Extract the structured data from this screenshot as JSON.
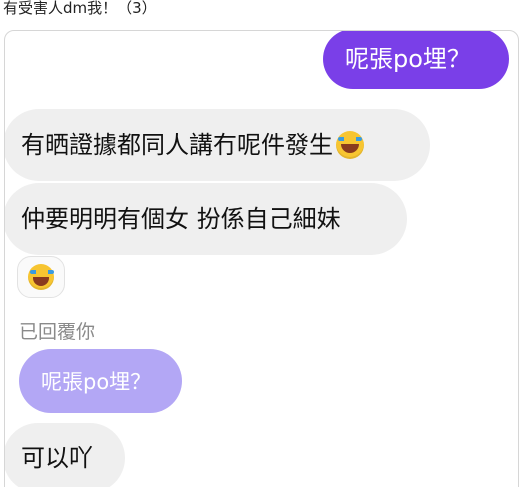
{
  "post": {
    "title": "有受害人dm我！（3）"
  },
  "chat": {
    "sent_message": "呢張po埋？",
    "received": [
      {
        "text": "有晒證據都同人講冇呢件發生",
        "emoji": "laughing-with-tears"
      },
      {
        "text": "仲要明明有個女 扮係自己細妹"
      }
    ],
    "emoji_message": {
      "emoji": "laughing-with-tears"
    },
    "reply_label": "已回覆你",
    "quoted_message": "呢張po埋？",
    "last_reply": "可以吖"
  },
  "colors": {
    "sent_bubble": "#7a3fe8",
    "received_bubble": "#efefef",
    "quoted_bubble": "#b3a7f5",
    "reply_label": "#8a8a8a"
  }
}
